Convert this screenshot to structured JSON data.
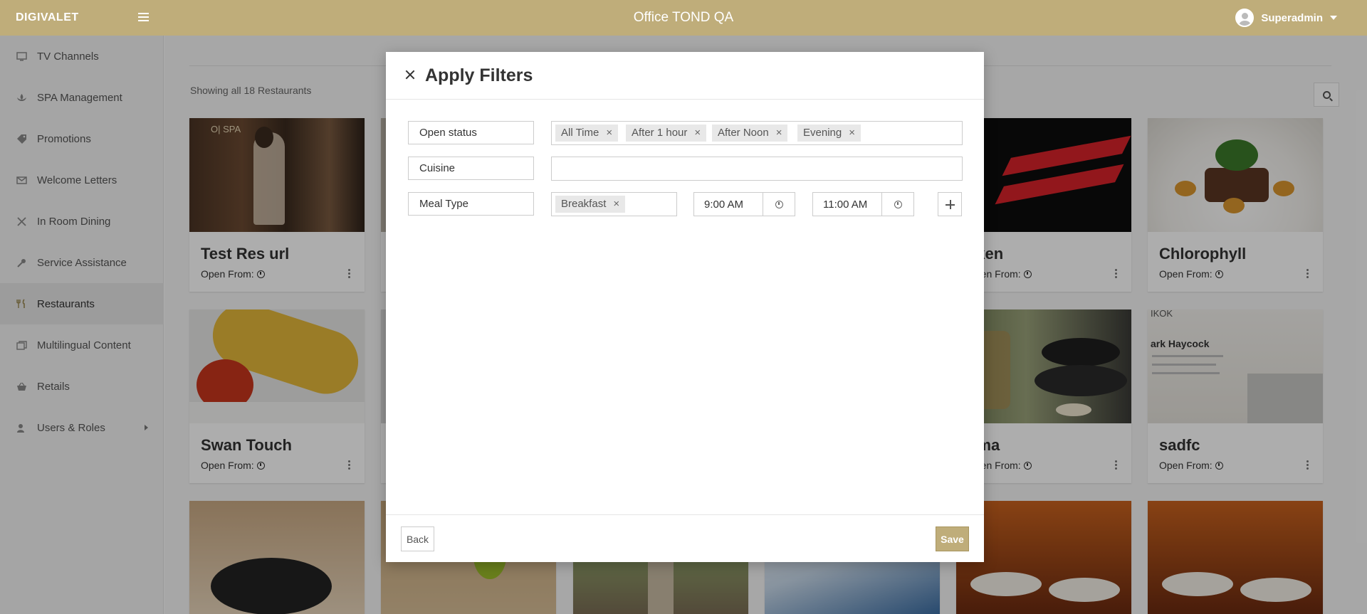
{
  "header": {
    "brand": "DIGIVALET",
    "title": "Office TOND QA",
    "user_name": "Superadmin"
  },
  "sidebar": {
    "items": [
      {
        "label": "TV Channels",
        "icon": "tv-icon"
      },
      {
        "label": "SPA Management",
        "icon": "spa-icon"
      },
      {
        "label": "Promotions",
        "icon": "tag-icon"
      },
      {
        "label": "Welcome Letters",
        "icon": "envelope-icon"
      },
      {
        "label": "In Room Dining",
        "icon": "utensils-cross-icon"
      },
      {
        "label": "Service Assistance",
        "icon": "key-icon"
      },
      {
        "label": "Restaurants",
        "icon": "fork-knife-icon",
        "active": true
      },
      {
        "label": "Multilingual Content",
        "icon": "pages-icon"
      },
      {
        "label": "Retails",
        "icon": "basket-icon"
      },
      {
        "label": "Users & Roles",
        "icon": "user-icon",
        "has_submenu": true
      }
    ]
  },
  "main": {
    "showing_text": "Showing all 18 Restaurants",
    "open_from_label": "Open From:",
    "cards": [
      {
        "name": "Test Res url"
      },
      {
        "name": ""
      },
      {
        "name": ""
      },
      {
        "name": ""
      },
      {
        "name": "aken"
      },
      {
        "name": "Chlorophyll"
      },
      {
        "name": "Swan Touch"
      },
      {
        "name": ""
      },
      {
        "name": ""
      },
      {
        "name": ""
      },
      {
        "name": "oma"
      },
      {
        "name": "sadfc"
      }
    ],
    "image_texts": {
      "spa_logo": "O| SPA",
      "haycock_top": "IKOK",
      "haycock_title": "ark Haycock"
    }
  },
  "modal": {
    "title": "Apply Filters",
    "filters": {
      "open_status": {
        "label": "Open status",
        "chips": [
          "All Time",
          "After 1 hour",
          "After Noon",
          "Evening"
        ]
      },
      "cuisine": {
        "label": "Cuisine",
        "chips": []
      },
      "meal_type": {
        "label": "Meal Type",
        "chips": [
          "Breakfast"
        ],
        "start_time": "9:00 AM",
        "end_time": "11:00 AM"
      }
    },
    "remove_glyph": "×",
    "back_label": "Back",
    "save_label": "Save"
  },
  "colors": {
    "brand": "#bfad7a",
    "sidebar_bg": "#f3f3f3",
    "chip_bg": "#e8e8e8"
  }
}
